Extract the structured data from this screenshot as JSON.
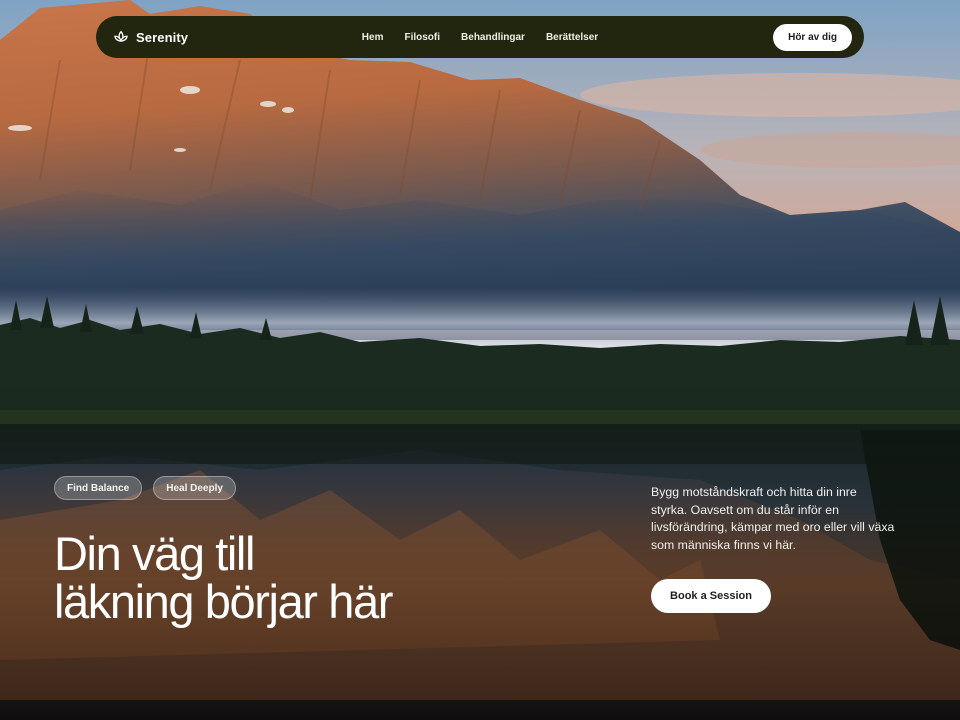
{
  "brand": {
    "name": "Serenity",
    "icon": "lotus-icon"
  },
  "nav": {
    "links": [
      {
        "label": "Hem"
      },
      {
        "label": "Filosofi"
      },
      {
        "label": "Behandlingar"
      },
      {
        "label": "Berättelser"
      }
    ],
    "cta_label": "Hör av dig"
  },
  "hero": {
    "tags": [
      {
        "label": "Find Balance"
      },
      {
        "label": "Heal Deeply"
      }
    ],
    "headline_line1": "Din väg till",
    "headline_line2": "läkning börjar här",
    "intro": "Bygg motståndskraft och hitta din inre styrka. Oavsett om du står inför en livsförändring, kämpar med oro eller vill växa som människa finns vi här.",
    "cta_label": "Book a Session"
  },
  "colors": {
    "nav_background": "#22260f",
    "button_background": "#ffffff",
    "button_text": "#1e1e1e",
    "text": "#ffffff"
  }
}
